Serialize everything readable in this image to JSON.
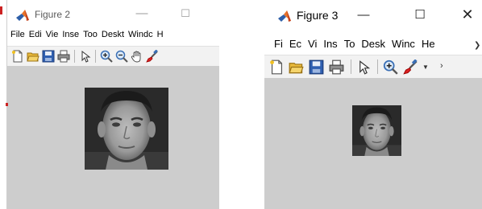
{
  "figure2": {
    "title": "Figure 2",
    "buttons": {
      "minimize": "—",
      "maximize": "☐"
    },
    "menu": [
      "File",
      "Edi",
      "Vie",
      "Inse",
      "Too",
      "Deskt",
      "Windc",
      "H"
    ],
    "toolbar": [
      "new-file",
      "open-folder",
      "save",
      "print",
      "select-arrow",
      "zoom-in",
      "zoom-out",
      "pan-hand",
      "brush"
    ],
    "image": "face-photo"
  },
  "figure3": {
    "title": "Figure 3",
    "buttons": {
      "minimize": "—",
      "maximize": "☐",
      "close": "✕"
    },
    "menu": [
      "Fi",
      "Ec",
      "Vi",
      "Ins",
      "To",
      "Desk",
      "Winc",
      "He"
    ],
    "toolbar": [
      "new-file",
      "open-folder",
      "save",
      "print",
      "select-arrow",
      "zoom-in",
      "brush"
    ],
    "image": "face-photo-small"
  },
  "colors": {
    "figure_background": "#cdcdcd",
    "toolbar_background": "#f2f2f2",
    "matlab_icon_orange": "#e8732a",
    "matlab_icon_blue": "#2e5fa8"
  }
}
